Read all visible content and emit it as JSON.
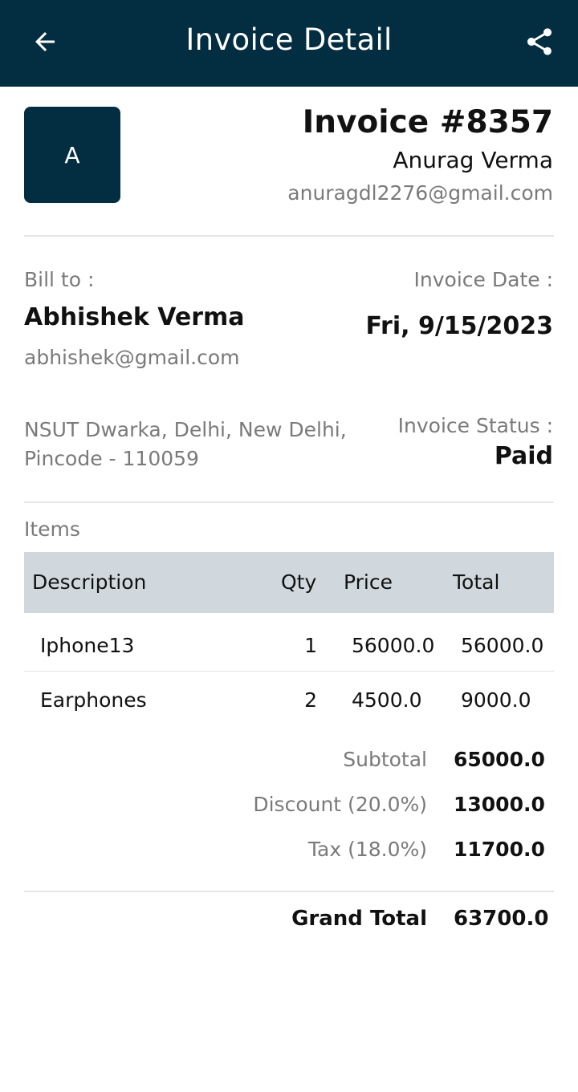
{
  "appbar": {
    "title": "Invoice Detail",
    "back_icon": "arrow-left-icon",
    "share_icon": "share-icon"
  },
  "header": {
    "avatar_letter": "A",
    "invoice_number": "Invoice #8357",
    "from_name": "Anurag Verma",
    "from_email": "anuragdl2276@gmail.com"
  },
  "billing": {
    "bill_to_label": "Bill to :",
    "name": "Abhishek Verma",
    "email": "abhishek@gmail.com",
    "address": "NSUT Dwarka, Delhi, New Delhi, Pincode - 110059",
    "date_label": "Invoice Date :",
    "date": "Fri, 9/15/2023",
    "status_label": "Invoice Status :",
    "status": "Paid"
  },
  "items": {
    "section_label": "Items",
    "headers": {
      "description": "Description",
      "qty": "Qty",
      "price": "Price",
      "total": "Total"
    },
    "rows": [
      {
        "description": "Iphone13",
        "qty": "1",
        "price": "56000.0",
        "total": "56000.0"
      },
      {
        "description": "Earphones",
        "qty": "2",
        "price": "4500.0",
        "total": "9000.0"
      }
    ]
  },
  "summary": {
    "subtotal_label": "Subtotal",
    "subtotal": "65000.0",
    "discount_label": "Discount (20.0%)",
    "discount": "13000.0",
    "tax_label": "Tax (18.0%)",
    "tax": "11700.0",
    "grand_total_label": "Grand Total",
    "grand_total": "63700.0"
  },
  "colors": {
    "primary": "#032d40",
    "table_header": "#d1d8dd",
    "muted_text": "#7a7a7a"
  }
}
